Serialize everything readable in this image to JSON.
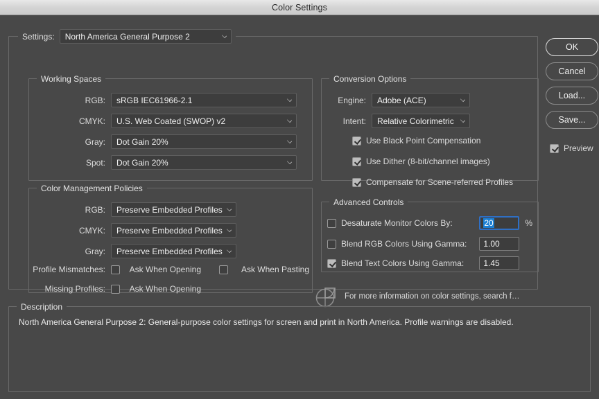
{
  "window": {
    "title": "Color Settings"
  },
  "settings": {
    "label": "Settings:",
    "value": "North America General Purpose 2"
  },
  "working_spaces": {
    "title": "Working Spaces",
    "rows": [
      {
        "label": "RGB:",
        "value": "sRGB IEC61966-2.1"
      },
      {
        "label": "CMYK:",
        "value": "U.S. Web Coated (SWOP) v2"
      },
      {
        "label": "Gray:",
        "value": "Dot Gain 20%"
      },
      {
        "label": "Spot:",
        "value": "Dot Gain 20%"
      }
    ]
  },
  "policies": {
    "title": "Color Management Policies",
    "rows": [
      {
        "label": "RGB:",
        "value": "Preserve Embedded Profiles"
      },
      {
        "label": "CMYK:",
        "value": "Preserve Embedded Profiles"
      },
      {
        "label": "Gray:",
        "value": "Preserve Embedded Profiles"
      }
    ],
    "profile_mismatches_label": "Profile Mismatches:",
    "ask_when_opening_mismatch": "Ask When Opening",
    "ask_when_pasting": "Ask When Pasting",
    "missing_profiles_label": "Missing Profiles:",
    "ask_when_opening_missing": "Ask When Opening",
    "checked": {
      "ask_when_opening_mismatch": false,
      "ask_when_pasting": false,
      "ask_when_opening_missing": false
    }
  },
  "conversion": {
    "title": "Conversion Options",
    "engine_label": "Engine:",
    "engine_value": "Adobe (ACE)",
    "intent_label": "Intent:",
    "intent_value": "Relative Colorimetric",
    "black_point_label": "Use Black Point Compensation",
    "dither_label": "Use Dither (8-bit/channel images)",
    "scene_referred_label": "Compensate for Scene-referred Profiles",
    "checked": {
      "black_point": true,
      "dither": true,
      "scene_referred": true
    }
  },
  "advanced": {
    "title": "Advanced Controls",
    "desaturate_label": "Desaturate Monitor Colors By:",
    "desaturate_value": "20",
    "percent_sign": "%",
    "blend_rgb_label": "Blend RGB Colors Using Gamma:",
    "blend_rgb_value": "1.00",
    "blend_text_label": "Blend Text Colors Using Gamma:",
    "blend_text_value": "1.45",
    "checked": {
      "desaturate": false,
      "blend_rgb": false,
      "blend_text": true
    }
  },
  "footer": {
    "info_text": "For more information on color settings, search f…"
  },
  "description": {
    "title": "Description",
    "text": "North America General Purpose 2:  General-purpose color settings for screen and print in North America. Profile warnings are disabled."
  },
  "buttons": {
    "ok": "OK",
    "cancel": "Cancel",
    "load": "Load...",
    "save": "Save...",
    "preview_label": "Preview",
    "preview_checked": true
  },
  "colors": {
    "background": "#484848",
    "accent_blue": "#1b7fd4",
    "focus_ring": "#2f6fc4",
    "border": "#696969"
  }
}
